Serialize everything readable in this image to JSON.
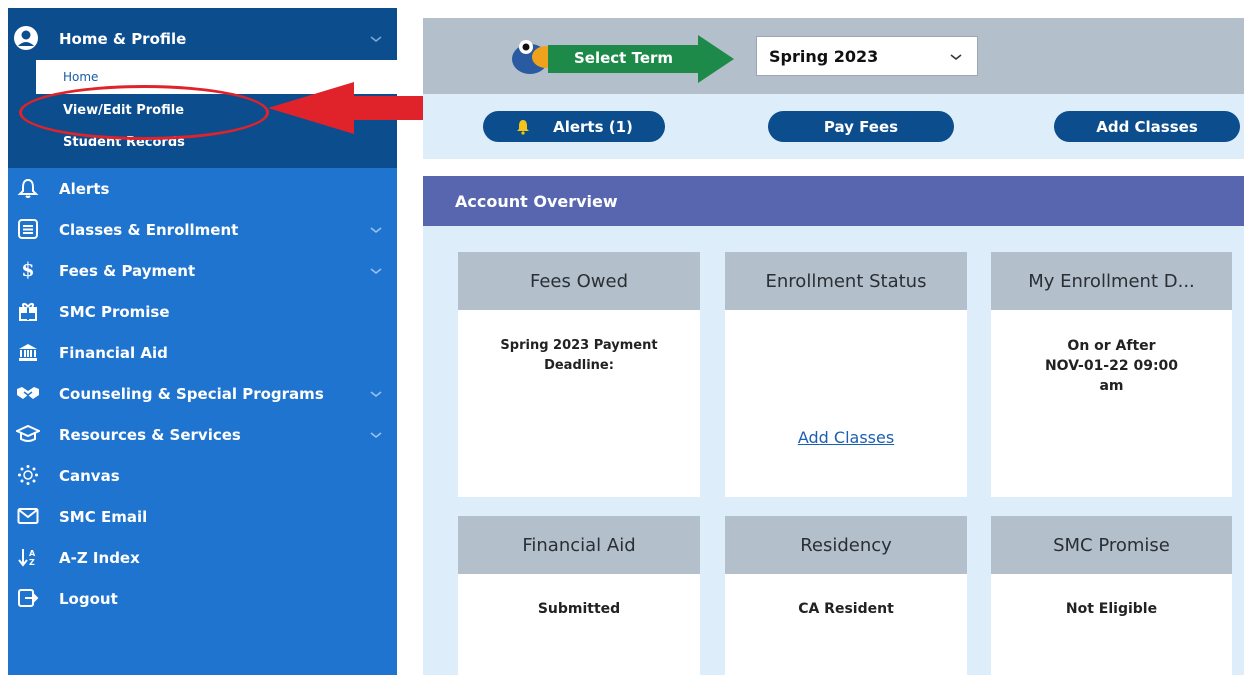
{
  "sidebar": {
    "profile_label": "Home & Profile",
    "sub_items": [
      "Home",
      "View/Edit Profile",
      "Student Records"
    ],
    "menu": [
      {
        "label": "Alerts",
        "icon": "bell-icon",
        "has_chevron": false
      },
      {
        "label": "Classes & Enrollment",
        "icon": "list-icon",
        "has_chevron": true
      },
      {
        "label": "Fees & Payment",
        "icon": "dollar-icon",
        "has_chevron": true
      },
      {
        "label": "SMC Promise",
        "icon": "gift-icon",
        "has_chevron": false
      },
      {
        "label": "Financial Aid",
        "icon": "bank-icon",
        "has_chevron": false
      },
      {
        "label": "Counseling & Special Programs",
        "icon": "handshake-icon",
        "has_chevron": true
      },
      {
        "label": "Resources & Services",
        "icon": "graduation-cap-icon",
        "has_chevron": true
      },
      {
        "label": "Canvas",
        "icon": "canvas-icon",
        "has_chevron": false
      },
      {
        "label": "SMC Email",
        "icon": "envelope-icon",
        "has_chevron": false
      },
      {
        "label": "A-Z Index",
        "icon": "sort-az-icon",
        "has_chevron": false
      },
      {
        "label": "Logout",
        "icon": "logout-icon",
        "has_chevron": false
      }
    ]
  },
  "term": {
    "select_label": "Select Term",
    "value": "Spring 2023"
  },
  "quick_actions": {
    "alerts": "Alerts (1)",
    "pay_fees": "Pay Fees",
    "add_classes": "Add Classes"
  },
  "overview": {
    "title": "Account Overview",
    "cards": [
      {
        "title": "Fees Owed",
        "lines": [
          "Spring 2023 Payment",
          "Deadline:"
        ]
      },
      {
        "title": "Enrollment Status",
        "link": "Add Classes"
      },
      {
        "title": "My Enrollment D...",
        "lines": [
          "On or After",
          "NOV-01-22 09:00",
          "am"
        ]
      },
      {
        "title": "Financial Aid",
        "lines": [
          "Submitted"
        ]
      },
      {
        "title": "Residency",
        "lines": [
          "CA Resident"
        ]
      },
      {
        "title": "SMC Promise",
        "lines": [
          "Not Eligible"
        ]
      }
    ]
  },
  "colors": {
    "sidebar_blue": "#1f74d0",
    "sidebar_dark": "#0c4d8e",
    "header_purple": "#5866b0",
    "annotation_red": "#e0232a",
    "term_green": "#1e8a4a"
  }
}
